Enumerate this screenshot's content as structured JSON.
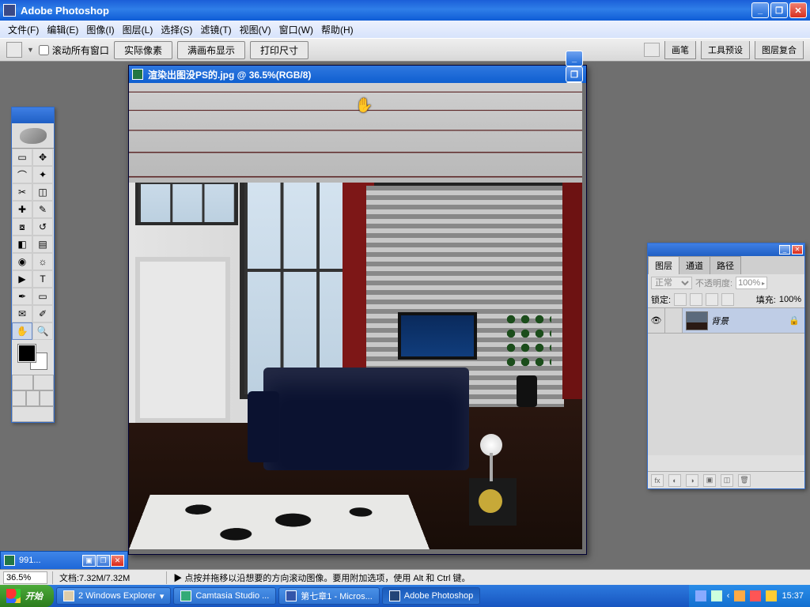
{
  "app": {
    "title": "Adobe Photoshop"
  },
  "menu": {
    "file": "文件(F)",
    "edit": "编辑(E)",
    "image": "图像(I)",
    "layer": "图层(L)",
    "select": "选择(S)",
    "filter": "滤镜(T)",
    "view": "视图(V)",
    "window": "窗口(W)",
    "help": "帮助(H)"
  },
  "options": {
    "scroll_all": "滚动所有窗口",
    "actual": "实际像素",
    "fit": "满画布显示",
    "print": "打印尺寸",
    "tab_brush": "画笔",
    "tab_tool": "工具预设",
    "tab_comp": "图层复合"
  },
  "doc": {
    "title": "渲染出图没PS的.jpg @ 36.5%(RGB/8)"
  },
  "layers": {
    "tab_layer": "图层",
    "tab_channel": "通道",
    "tab_path": "路径",
    "blend": "正常",
    "opacity_lbl": "不透明度:",
    "opacity": "100%",
    "lock_lbl": "锁定:",
    "fill_lbl": "填充:",
    "fill": "100%",
    "bg_layer": "背景"
  },
  "minidoc": {
    "title": "991..."
  },
  "status": {
    "zoom": "36.5%",
    "docinfo": "文档:7.32M/7.32M",
    "tip": "▶ 点按并拖移以沿想要的方向滚动图像。要用附加选项，使用 Alt 和 Ctrl 键。"
  },
  "taskbar": {
    "start": "开始",
    "t1": "2 Windows Explorer",
    "t1_suffix": "▾",
    "t2": "Camtasia Studio ...",
    "t3": "第七章1 - Micros...",
    "t4": "Adobe Photoshop",
    "clock": "15:37"
  }
}
